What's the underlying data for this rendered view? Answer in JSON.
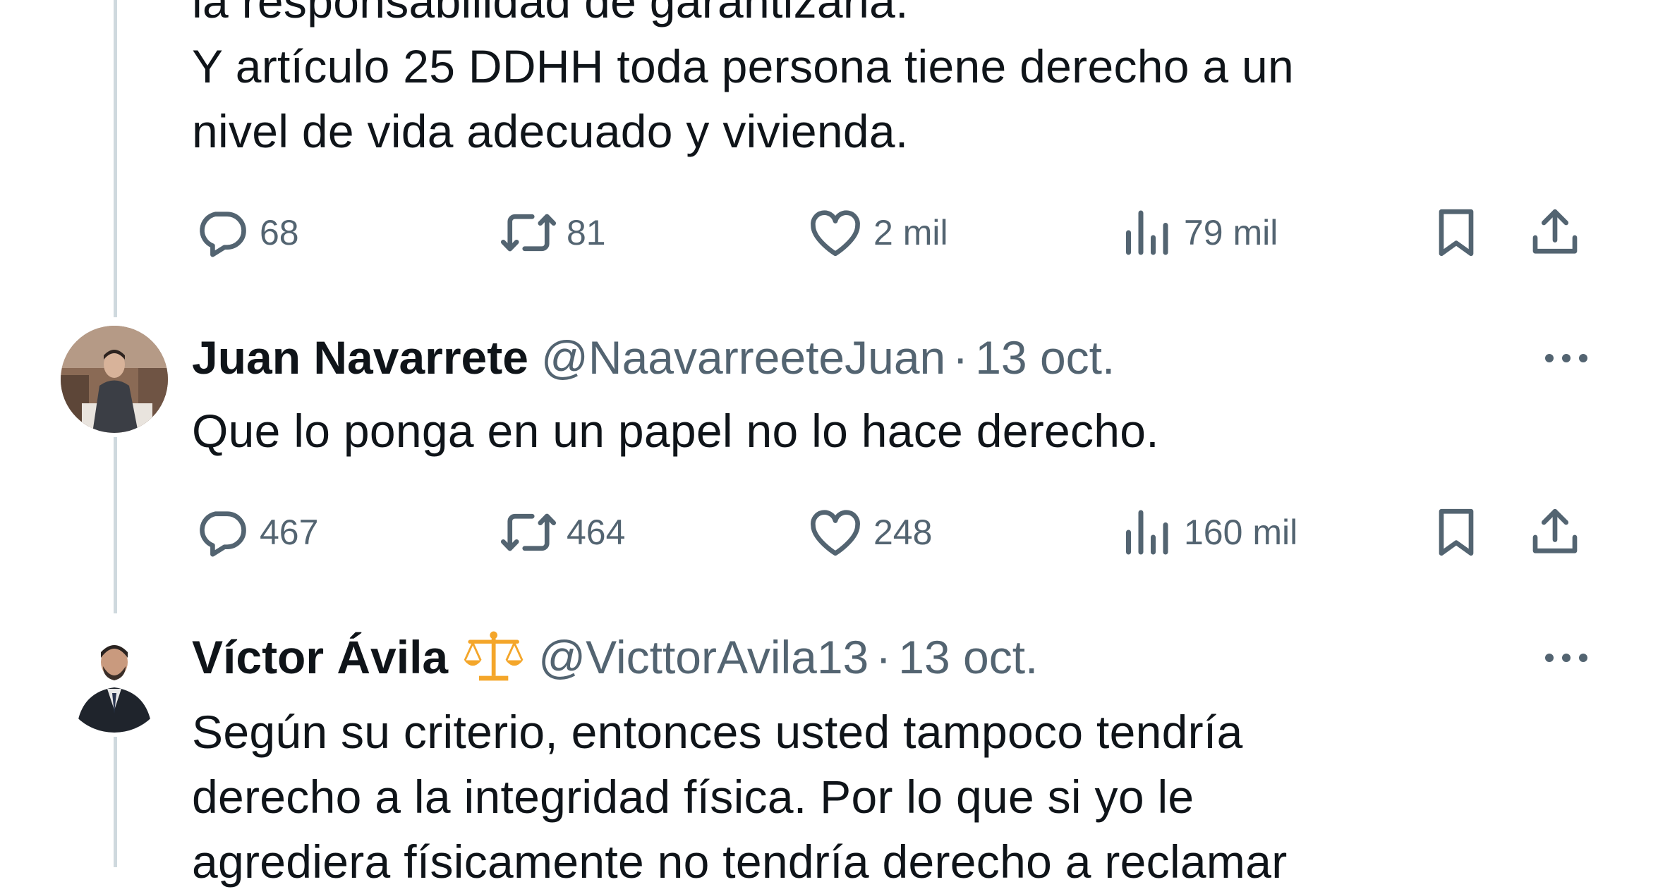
{
  "tweet1": {
    "text_lines": [
      "la responsabilidad de garantizarla.",
      "Y artículo 25 DDHH toda persona tiene derecho a un",
      "nivel de vida adecuado y vivienda."
    ],
    "replies": "68",
    "reposts": "81",
    "likes": "2 mil",
    "views": "79 mil"
  },
  "tweet2": {
    "name": "Juan Navarrete",
    "handle": "@NaavarreeteJuan",
    "separator": "·",
    "date": "13 oct.",
    "text_lines": [
      "Que lo ponga en un papel no lo hace derecho."
    ],
    "replies": "467",
    "reposts": "464",
    "likes": "248",
    "views": "160 mil"
  },
  "tweet3": {
    "name": "Víctor Ávila",
    "badge_icon": "scales-emoji",
    "handle": "@VicttorAvila13",
    "separator": "·",
    "date": "13 oct.",
    "text_lines": [
      "Según su criterio, entonces usted tampoco tendría",
      "derecho a la integridad física. Por lo que si yo le",
      "agrediera físicamente no tendría derecho a reclamar"
    ]
  },
  "colors": {
    "text": "#0f1419",
    "secondary": "#536471",
    "thread_line": "#cfd9de",
    "badge": "#f4a62a"
  }
}
